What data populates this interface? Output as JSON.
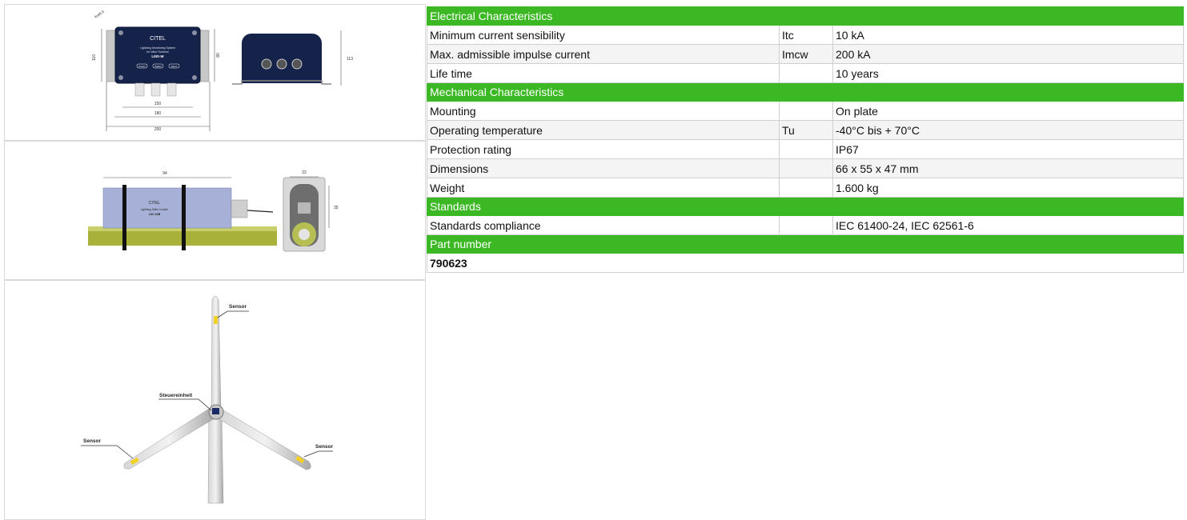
{
  "drawings": {
    "box": {
      "dims": [
        "110",
        "80",
        "113",
        "150",
        "180",
        "200",
        "4xø6,5"
      ],
      "brand": "CITEL",
      "model": "LMS-W",
      "subtitle_line1": "Lightning Monitoring System",
      "subtitle_line2": "for Wind Turbines",
      "buttons": [
        "Power",
        "Status",
        "Alarm"
      ]
    },
    "counter": {
      "dims": [
        "94",
        "22",
        "35"
      ],
      "brand": "CITEL",
      "subtitle": "Lightning Strike Counter",
      "model": "LSC-02B"
    },
    "turbine": {
      "labels": [
        "Sensor",
        "Steuereinheit",
        "Sensor",
        "Sensor"
      ]
    }
  },
  "sections": [
    {
      "title": "Electrical Characteristics",
      "rows": [
        {
          "label": "Minimum current sensibility",
          "symbol": "Itc",
          "value": "10 kA"
        },
        {
          "label": "Max. admissible impulse current",
          "symbol": "Imcw",
          "value": "200 kA"
        },
        {
          "label": "Life time",
          "symbol": "",
          "value": "10 years"
        }
      ]
    },
    {
      "title": "Mechanical Characteristics",
      "rows": [
        {
          "label": "Mounting",
          "symbol": "",
          "value": "On plate"
        },
        {
          "label": "Operating temperature",
          "symbol": "Tu",
          "value": "-40°C bis + 70°C"
        },
        {
          "label": "Protection rating",
          "symbol": "",
          "value": "IP67"
        },
        {
          "label": "Dimensions",
          "symbol": "",
          "value": "66 x 55 x 47 mm"
        },
        {
          "label": "Weight",
          "symbol": "",
          "value": "1.600 kg"
        }
      ]
    },
    {
      "title": "Standards",
      "rows": [
        {
          "label": "Standards compliance",
          "symbol": "",
          "value": "IEC 61400-24, IEC 62561-6"
        }
      ]
    }
  ],
  "part": {
    "title": "Part number",
    "value": "790623"
  },
  "colors": {
    "section_header": "#3cb824",
    "row_alt": "#f4f4f4",
    "border": "#cfcfcf"
  }
}
